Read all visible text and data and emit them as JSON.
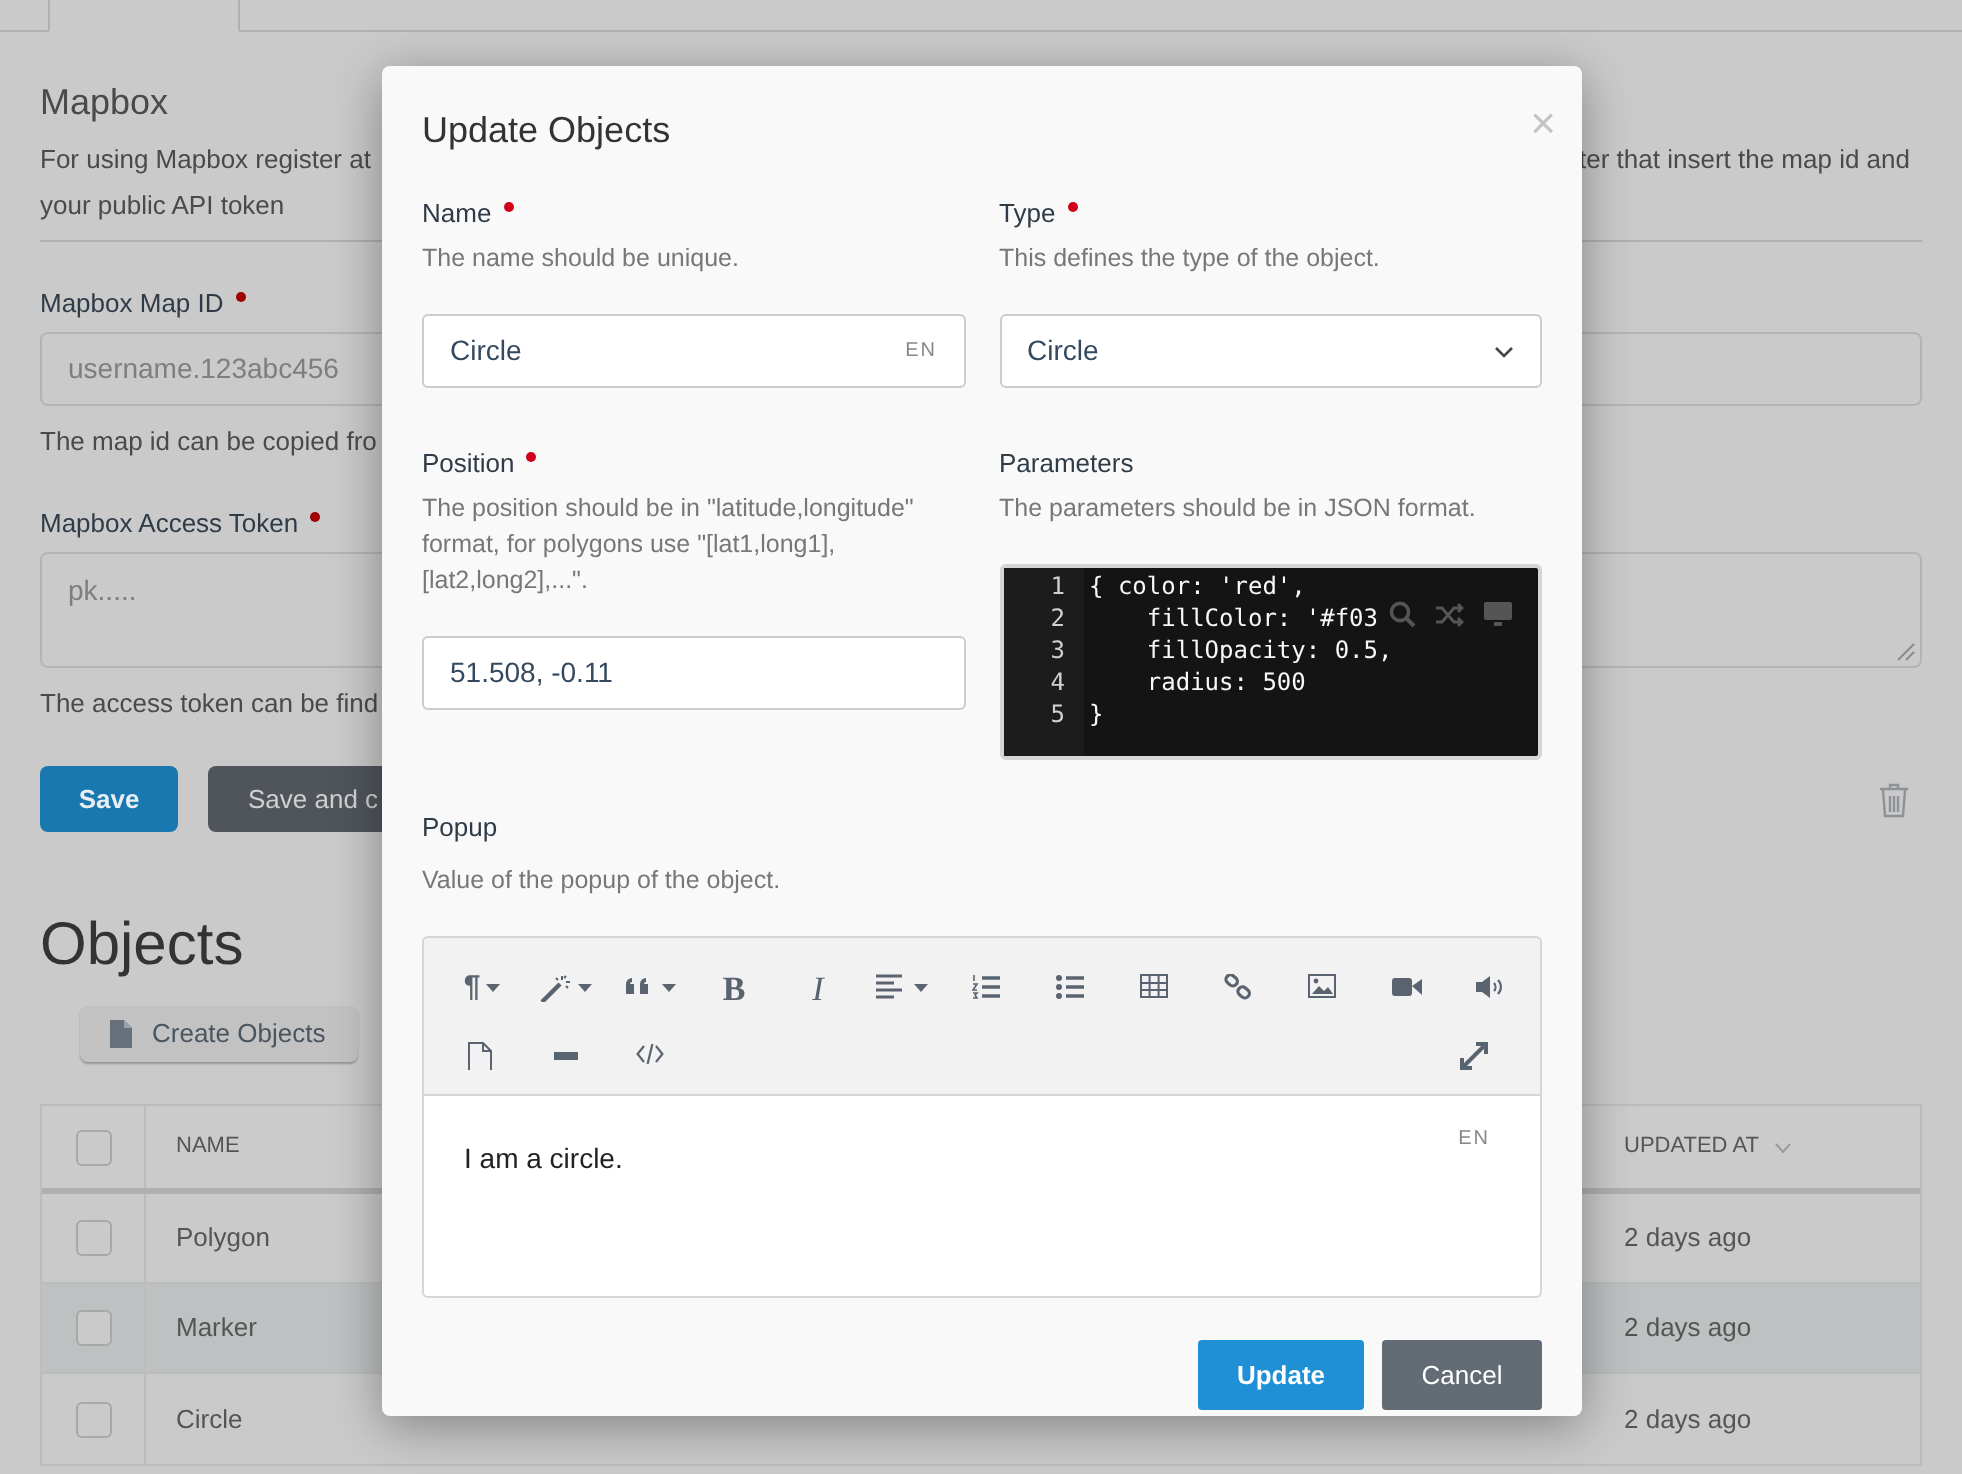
{
  "mapbox": {
    "title": "Mapbox",
    "description_left": "For using Mapbox register at",
    "description_right": "ter that insert the map id and",
    "description_line_2": "your public API token"
  },
  "fields": [
    {
      "kind": "input",
      "label": "Mapbox Map ID",
      "required": true,
      "placeholder": "username.123abc456",
      "help": "The map id can be copied fro"
    },
    {
      "kind": "textarea",
      "label": "Mapbox Access Token",
      "required": true,
      "placeholder": "pk.....",
      "help": "The access token can be find"
    }
  ],
  "buttons": [
    {
      "kind": "primary",
      "label": "Save"
    },
    {
      "kind": "secondary",
      "label": "Save and c"
    }
  ],
  "objects": {
    "title": "Objects",
    "create_button": "Create Objects",
    "table": {
      "header_checked": false,
      "columns": [
        {
          "label": "NAME",
          "sortable": false
        },
        {
          "label": "UPDATED AT",
          "sortable": true
        }
      ],
      "rows": [
        {
          "cells": [
            "Polygon",
            "2 days ago"
          ],
          "checked": false,
          "selected": false
        },
        {
          "cells": [
            "Marker",
            "2 days ago"
          ],
          "checked": false,
          "selected": true
        },
        {
          "cells": [
            "Circle",
            "2 days ago"
          ],
          "checked": false,
          "selected": false
        }
      ]
    }
  },
  "dialog": {
    "title": "Update Objects",
    "close": "×",
    "fields": [
      {
        "kind": "text",
        "label": "Name",
        "required": true,
        "description": "The name should be unique.",
        "value": "Circle",
        "lang": "EN"
      },
      {
        "kind": "select",
        "label": "Type",
        "required": true,
        "description": "This defines the type of the object.",
        "value": "Circle"
      },
      {
        "kind": "text",
        "label": "Position",
        "required": true,
        "description": "The position should be in \"latitude,longitude\" format, for polygons use \"[lat1,long1],[lat2,long2],...\".",
        "value": "51.508, -0.11"
      },
      {
        "kind": "code",
        "label": "Parameters",
        "required": false,
        "description": "The parameters should be in JSON format.",
        "lines": [
          {
            "number": "1",
            "text": "{ color: 'red',"
          },
          {
            "number": "2",
            "text": "    fillColor: '#f03"
          },
          {
            "number": "3",
            "text": "    fillOpacity: 0.5,"
          },
          {
            "number": "4",
            "text": "    radius: 500"
          },
          {
            "number": "5",
            "text": "}"
          }
        ]
      }
    ],
    "popup": {
      "label": "Popup",
      "description": "Value of the popup of the object.",
      "toolbar": [
        [
          {
            "kind": "paragraph",
            "glyph": "¶",
            "dropdown": true
          },
          {
            "kind": "magic",
            "dropdown": true
          },
          {
            "kind": "quote",
            "dropdown": true
          },
          {
            "kind": "bold",
            "glyph": "B",
            "dropdown": false
          },
          {
            "kind": "italic",
            "glyph": "I",
            "dropdown": false
          },
          {
            "kind": "align",
            "dropdown": true
          },
          {
            "kind": "ol",
            "dropdown": false
          },
          {
            "kind": "ul",
            "dropdown": false
          },
          {
            "kind": "table",
            "dropdown": false
          },
          {
            "kind": "link",
            "dropdown": false
          },
          {
            "kind": "picture",
            "dropdown": false
          },
          {
            "kind": "video",
            "dropdown": false
          },
          {
            "kind": "sound",
            "dropdown": false
          }
        ],
        [
          {
            "kind": "file",
            "dropdown": false
          },
          {
            "kind": "hr",
            "dropdown": false
          },
          {
            "kind": "code",
            "dropdown": false
          },
          {
            "kind": "fullscreen",
            "dropdown": false
          }
        ]
      ],
      "content": "I am a circle.",
      "lang": "EN"
    },
    "buttons": [
      {
        "kind": "primary",
        "label": "Update"
      },
      {
        "kind": "secondary",
        "label": "Cancel"
      }
    ]
  }
}
